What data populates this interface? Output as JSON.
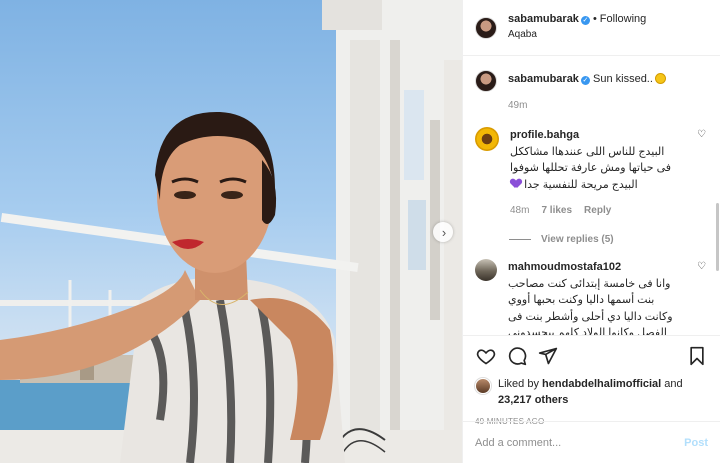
{
  "post": {
    "author": "sabamubarak",
    "follow_status": "Following",
    "location": "Aqaba",
    "caption": "Sun kissed..",
    "caption_time": "49m"
  },
  "comments": [
    {
      "user": "profile.bahga",
      "text": "البيدج للناس اللى عنندهاا مشاككل فى حياتها ومش عارفة تحللها شوفوا البيدج مريحة للنفسية جدا",
      "time": "48m",
      "likes": "7 likes",
      "reply_label": "Reply",
      "view_replies": "View replies (5)"
    },
    {
      "user": "mahmoudmostafa102",
      "text": "وانا فى خامسة إبتدائى كنت مصاحب بنت أسمها داليا وكنت بحبها أووي وكانت داليا دي أحلى وأشطر بنت فى الفصل وكانوا الولاد كلهم بيحسدوني"
    }
  ],
  "likes": {
    "prefix": "Liked by",
    "user": "hendabdelhalimofficial",
    "joiner": "and",
    "others": "23,217 others"
  },
  "timestamp": "49 MINUTES AGO",
  "composer": {
    "placeholder": "Add a comment...",
    "post_label": "Post"
  },
  "colors": {
    "accent_blue": "#3897f0",
    "post_button_disabled": "#b2dffc",
    "muted_text": "#8e8e8e"
  },
  "icons": [
    "verified-badge-icon",
    "heart-icon",
    "comment-icon",
    "share-icon",
    "bookmark-icon",
    "next-arrow-icon"
  ]
}
